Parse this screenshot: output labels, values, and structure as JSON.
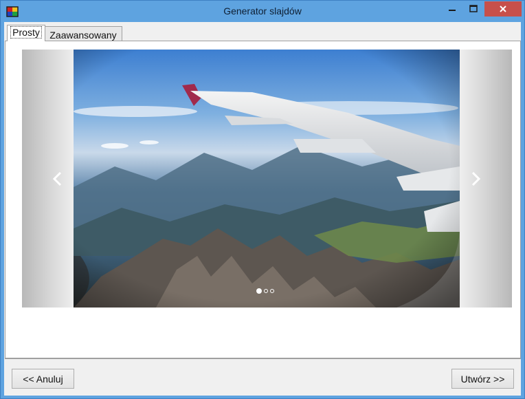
{
  "window": {
    "title": "Generator slajdów"
  },
  "tabs": [
    {
      "label": "Prosty",
      "active": true
    },
    {
      "label": "Zaawansowany",
      "active": false
    }
  ],
  "slider": {
    "slide_count": 3,
    "active_slide": 1,
    "image_description": "airplane-wing-over-mountains"
  },
  "buttons": {
    "cancel_label": "<< Anuluj",
    "create_label": "Utwórz >>"
  },
  "colors": {
    "titlebar": "#5ea3e0",
    "close_button": "#c7504b",
    "client_background": "#f0f0f0"
  }
}
